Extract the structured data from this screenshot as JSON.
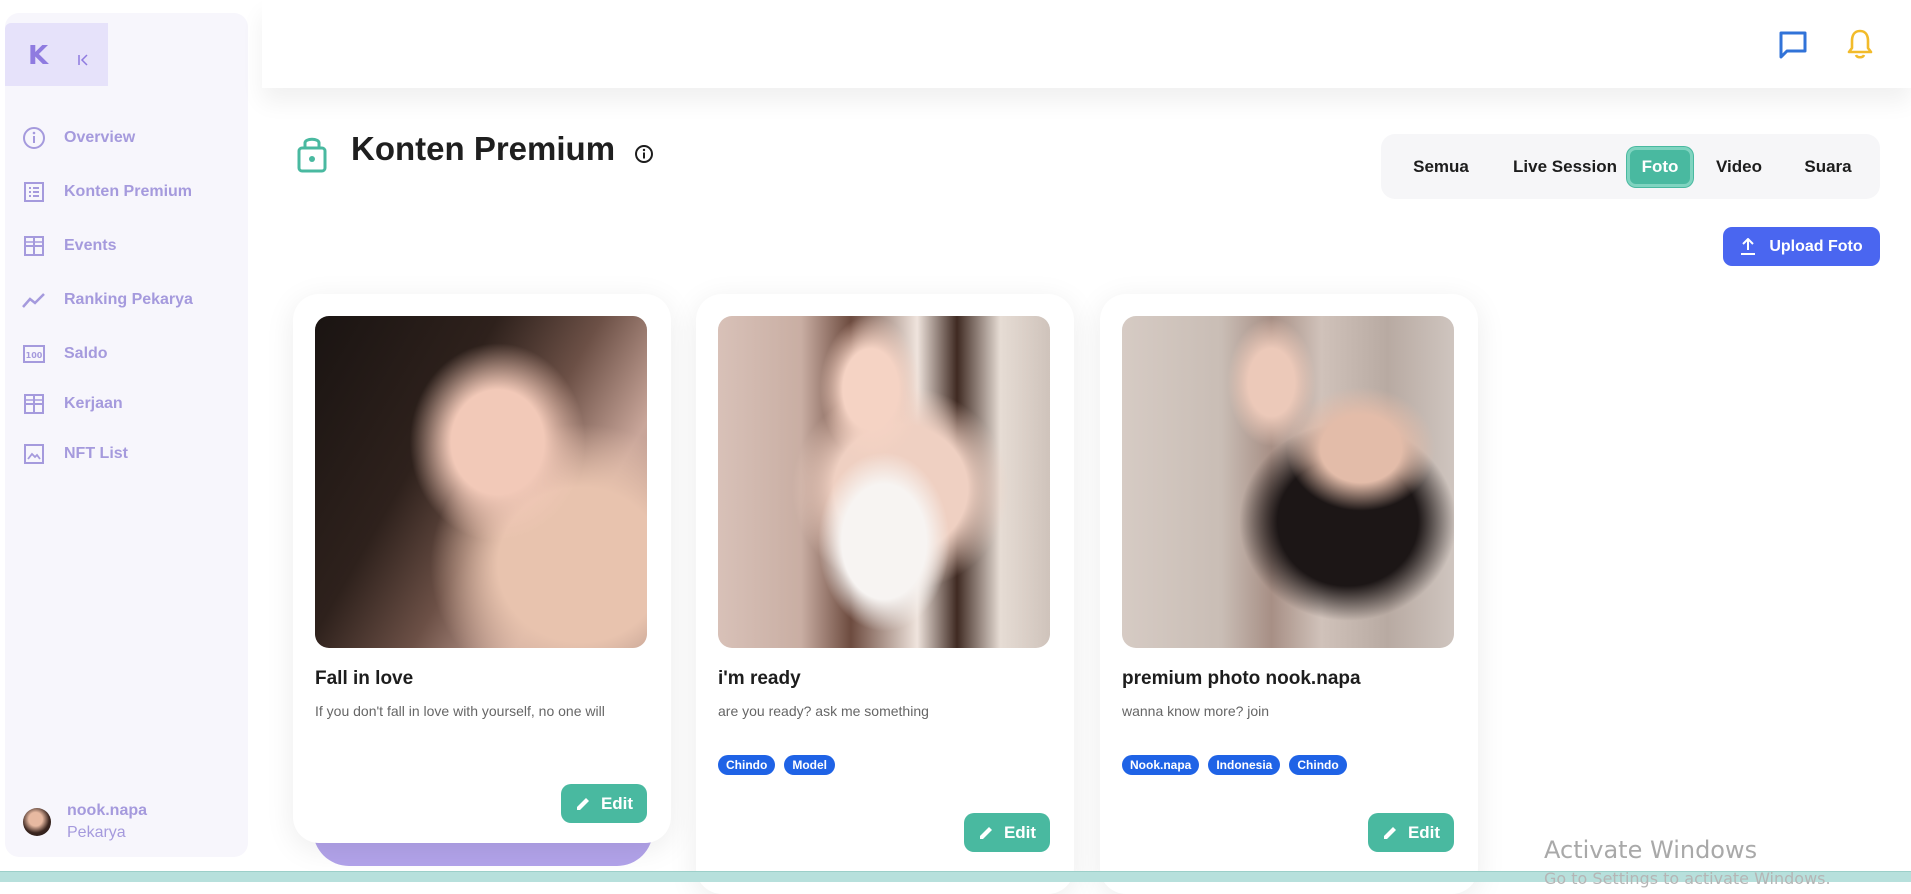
{
  "sidebar": {
    "logo": "K",
    "items": [
      {
        "label": "Overview",
        "icon": "info-circle-icon"
      },
      {
        "label": "Konten Premium",
        "icon": "list-icon"
      },
      {
        "label": "Events",
        "icon": "grid-icon"
      },
      {
        "label": "Ranking Pekarya",
        "icon": "trend-line-icon"
      },
      {
        "label": "Saldo",
        "icon": "money-icon"
      },
      {
        "label": "Kerjaan",
        "icon": "grid-icon"
      },
      {
        "label": "NFT List",
        "icon": "image-icon"
      }
    ],
    "user": {
      "name": "nook.napa",
      "role": "Pekarya"
    }
  },
  "header": {
    "title": "Konten Premium",
    "tabs": [
      {
        "label": "Semua",
        "active": false
      },
      {
        "label": "Live Session",
        "active": false
      },
      {
        "label": "Foto",
        "active": true
      },
      {
        "label": "Video",
        "active": false
      },
      {
        "label": "Suara",
        "active": false
      }
    ],
    "upload_label": "Upload Foto"
  },
  "cards": [
    {
      "title": "Fall in love",
      "description": "If you don't fall in love with yourself, no one will",
      "tags": [],
      "edit_label": "Edit"
    },
    {
      "title": "i'm ready",
      "description": "are you ready? ask me something",
      "tags": [
        "Chindo",
        "Model"
      ],
      "edit_label": "Edit"
    },
    {
      "title": "premium photo nook.napa",
      "description": "wanna know more? join",
      "tags": [
        "Nook.napa",
        "Indonesia",
        "Chindo"
      ],
      "edit_label": "Edit"
    }
  ],
  "watermark": {
    "line1": "Activate Windows",
    "line2": "Go to Settings to activate Windows."
  },
  "colors": {
    "accent": "#49b9a0",
    "primary": "#4a66f0",
    "sidebar_text": "#a59add",
    "tag": "#1f63e6"
  }
}
